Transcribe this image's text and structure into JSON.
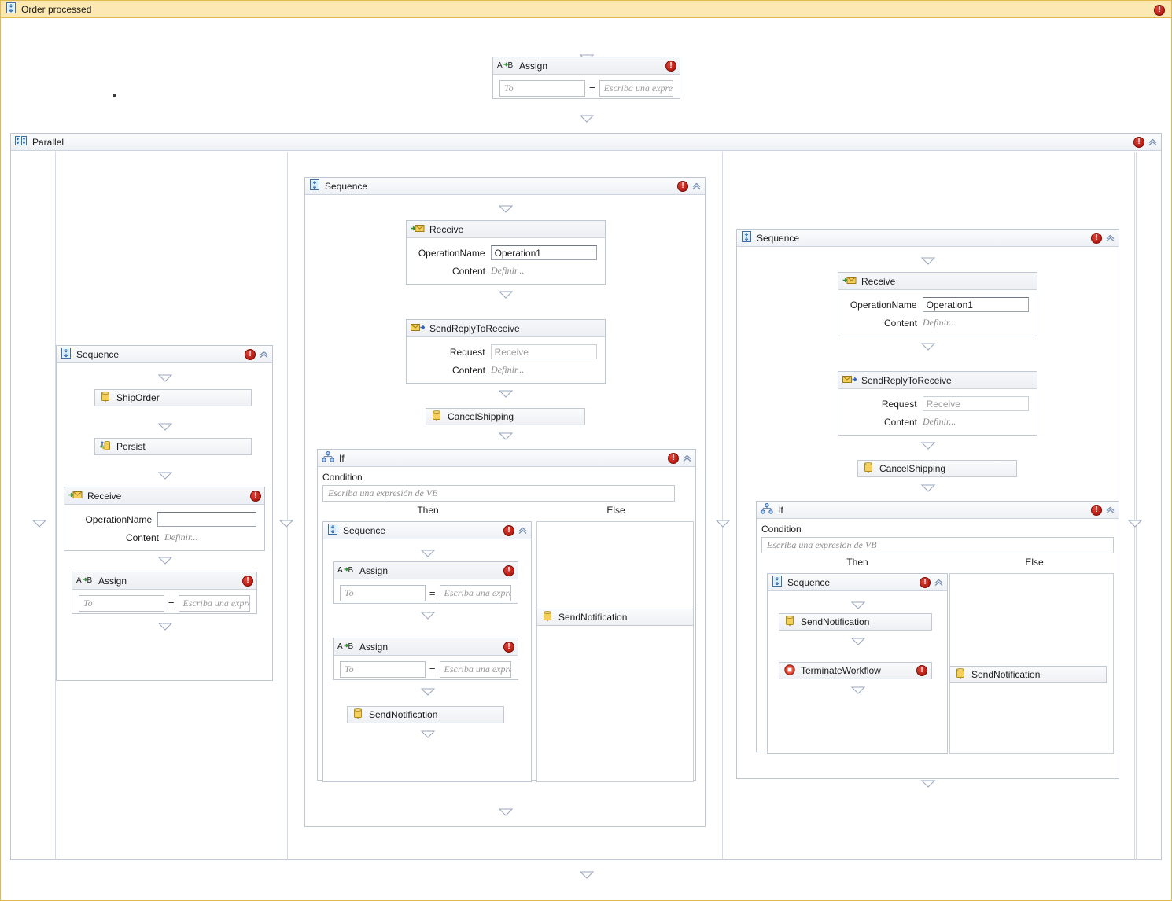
{
  "window": {
    "title": "Order processed",
    "icon": "sequence-icon",
    "has_error": true
  },
  "labels": {
    "operation_name": "OperationName",
    "content": "Content",
    "request": "Request",
    "condition": "Condition",
    "then": "Then",
    "else": "Else",
    "define_placeholder": "Definir...",
    "assign_to_placeholder": "To",
    "assign_expr_placeholder": "Escriba una expresi",
    "assign_equals": "=",
    "vb_expression_placeholder": "Escriba una expresión de VB",
    "receive_request_placeholder": "Receive"
  },
  "colors": {
    "root_header_bg": "#fce8b2",
    "root_border": "#e0b94f",
    "activity_border": "#bfc7d2",
    "header_gradient_top": "#f6f7f9",
    "header_gradient_bottom": "#eceff3",
    "error_red": "#b81d14",
    "arrow_outline": "#9aa7bd",
    "icon_yellow": "#f2cb52",
    "icon_green": "#3d9c3d",
    "icon_blue": "#4a79c4"
  },
  "activities": {
    "top_assign": {
      "type": "Assign",
      "title": "Assign",
      "icon": "assign-icon",
      "has_error": true,
      "to": "",
      "value": ""
    },
    "parallel": {
      "type": "Parallel",
      "title": "Parallel",
      "icon": "parallel-icon",
      "has_error": true,
      "collapsible": true
    },
    "branch1": {
      "type": "Sequence",
      "title": "Sequence",
      "icon": "sequence-icon",
      "has_error": true,
      "children": [
        {
          "type": "ShipOrder",
          "title": "ShipOrder",
          "icon": "activity-cylinder-icon",
          "has_error": false
        },
        {
          "type": "Persist",
          "title": "Persist",
          "icon": "persist-icon",
          "has_error": false
        },
        {
          "type": "Receive",
          "title": "Receive",
          "icon": "receive-icon",
          "has_error": true,
          "operation_name": "",
          "content": "Definir..."
        },
        {
          "type": "Assign",
          "title": "Assign",
          "icon": "assign-icon",
          "has_error": true,
          "to": "",
          "value": ""
        }
      ]
    },
    "branch2": {
      "type": "Sequence",
      "title": "Sequence",
      "icon": "sequence-icon",
      "has_error": true,
      "children": [
        {
          "type": "Receive",
          "title": "Receive",
          "icon": "receive-icon",
          "has_error": false,
          "operation_name": "Operation1",
          "content": "Definir..."
        },
        {
          "type": "SendReplyToReceive",
          "title": "SendReplyToReceive",
          "icon": "send-reply-icon",
          "has_error": false,
          "request": "Receive",
          "content": "Definir..."
        },
        {
          "type": "CancelShipping",
          "title": "CancelShipping",
          "icon": "activity-cylinder-icon",
          "has_error": false
        },
        {
          "type": "If",
          "title": "If",
          "icon": "if-icon",
          "has_error": true,
          "condition": "",
          "then": {
            "type": "Sequence",
            "title": "Sequence",
            "icon": "sequence-icon",
            "has_error": true,
            "children": [
              {
                "type": "Assign",
                "title": "Assign",
                "icon": "assign-icon",
                "has_error": true,
                "to": "",
                "value": ""
              },
              {
                "type": "Assign",
                "title": "Assign",
                "icon": "assign-icon",
                "has_error": true,
                "to": "",
                "value": ""
              },
              {
                "type": "SendNotification",
                "title": "SendNotification",
                "icon": "activity-cylinder-icon",
                "has_error": false
              }
            ]
          },
          "else": [
            {
              "type": "SendNotification",
              "title": "SendNotification",
              "icon": "activity-cylinder-icon",
              "has_error": false
            }
          ]
        }
      ]
    },
    "branch3": {
      "type": "Sequence",
      "title": "Sequence",
      "icon": "sequence-icon",
      "has_error": true,
      "children": [
        {
          "type": "Receive",
          "title": "Receive",
          "icon": "receive-icon",
          "has_error": false,
          "operation_name": "Operation1",
          "content": "Definir..."
        },
        {
          "type": "SendReplyToReceive",
          "title": "SendReplyToReceive",
          "icon": "send-reply-icon",
          "has_error": false,
          "request": "Receive",
          "content": "Definir..."
        },
        {
          "type": "CancelShipping",
          "title": "CancelShipping",
          "icon": "activity-cylinder-icon",
          "has_error": false
        },
        {
          "type": "If",
          "title": "If",
          "icon": "if-icon",
          "has_error": true,
          "condition": "",
          "then": {
            "type": "Sequence",
            "title": "Sequence",
            "icon": "sequence-icon",
            "has_error": true,
            "children": [
              {
                "type": "SendNotification",
                "title": "SendNotification",
                "icon": "activity-cylinder-icon",
                "has_error": false
              },
              {
                "type": "TerminateWorkflow",
                "title": "TerminateWorkflow",
                "icon": "terminate-icon",
                "has_error": true
              }
            ]
          },
          "else": [
            {
              "type": "SendNotification",
              "title": "SendNotification",
              "icon": "activity-cylinder-icon",
              "has_error": false
            }
          ]
        }
      ]
    }
  }
}
